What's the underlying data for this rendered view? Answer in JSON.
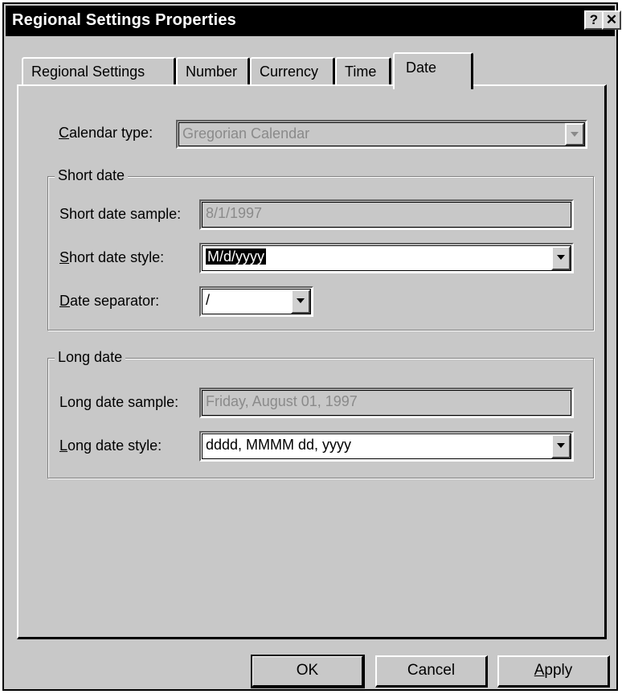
{
  "window": {
    "title": "Regional Settings Properties",
    "help_glyph": "?",
    "close_glyph": "✕"
  },
  "tabs": [
    {
      "label": "Regional Settings",
      "active": false
    },
    {
      "label": "Number",
      "active": false
    },
    {
      "label": "Currency",
      "active": false
    },
    {
      "label": "Time",
      "active": false
    },
    {
      "label": "Date",
      "active": true
    }
  ],
  "calendar": {
    "label": "Calendar type:",
    "value": "Gregorian Calendar"
  },
  "short_date": {
    "group_title": "Short date",
    "sample_label": "Short date sample:",
    "sample_value": "8/1/1997",
    "style_label": "Short date style:",
    "style_value": "M/d/yyyy",
    "separator_label": "Date separator:",
    "separator_value": "/"
  },
  "long_date": {
    "group_title": "Long date",
    "sample_label": "Long date sample:",
    "sample_value": "Friday, August 01, 1997",
    "style_label": "Long date style:",
    "style_value": "dddd, MMMM dd, yyyy"
  },
  "buttons": {
    "ok": "OK",
    "cancel": "Cancel",
    "apply": "Apply"
  }
}
